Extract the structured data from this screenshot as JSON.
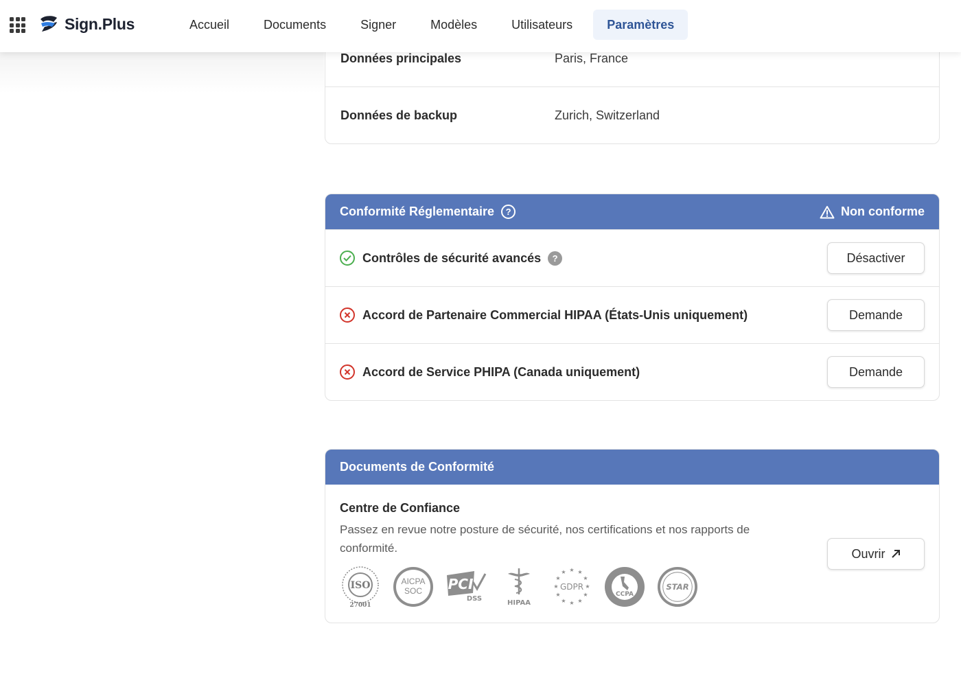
{
  "brand": {
    "name": "Sign.Plus"
  },
  "nav": {
    "items": [
      {
        "label": "Accueil"
      },
      {
        "label": "Documents"
      },
      {
        "label": "Signer"
      },
      {
        "label": "Modèles"
      },
      {
        "label": "Utilisateurs"
      },
      {
        "label": "Paramètres",
        "active": true
      }
    ]
  },
  "data_location": {
    "rows": [
      {
        "label": "Données principales",
        "value": "Paris, France"
      },
      {
        "label": "Données de backup",
        "value": "Zurich, Switzerland"
      }
    ]
  },
  "compliance": {
    "title": "Conformité Réglementaire",
    "help_icon": "?",
    "status_icon": "warning-icon",
    "status": "Non conforme",
    "items": [
      {
        "label": "Contrôles de sécurité avancés",
        "state": "enabled",
        "icon": "check-circle-icon",
        "has_help": true,
        "button": "Désactiver"
      },
      {
        "label": "Accord de Partenaire Commercial HIPAA (États-Unis uniquement)",
        "state": "disabled",
        "icon": "x-circle-icon",
        "button": "Demande"
      },
      {
        "label": "Accord de Service PHIPA (Canada uniquement)",
        "state": "disabled",
        "icon": "x-circle-icon",
        "button": "Demande"
      }
    ],
    "colors": {
      "header": "#5777b9",
      "ok": "#4caf50",
      "bad": "#d2352b"
    }
  },
  "documents": {
    "title": "Documents de Conformité",
    "trust_center": {
      "title": "Centre de Confiance",
      "description": "Passez en revue notre posture de sécurité, nos certifications et nos rapports de conformité.",
      "button": "Ouvrir",
      "badges": [
        {
          "name": "iso-27001",
          "text": "ISO",
          "sub": "27001"
        },
        {
          "name": "aicpa-soc",
          "text": "AICPA",
          "sub": "SOC"
        },
        {
          "name": "pci-dss",
          "text": "PCI",
          "sub": "DSS"
        },
        {
          "name": "hipaa",
          "text": "HIPAA"
        },
        {
          "name": "gdpr",
          "text": "GDPR"
        },
        {
          "name": "ccpa",
          "text": "CCPA"
        },
        {
          "name": "csa-star",
          "text": "STAR"
        }
      ]
    }
  }
}
